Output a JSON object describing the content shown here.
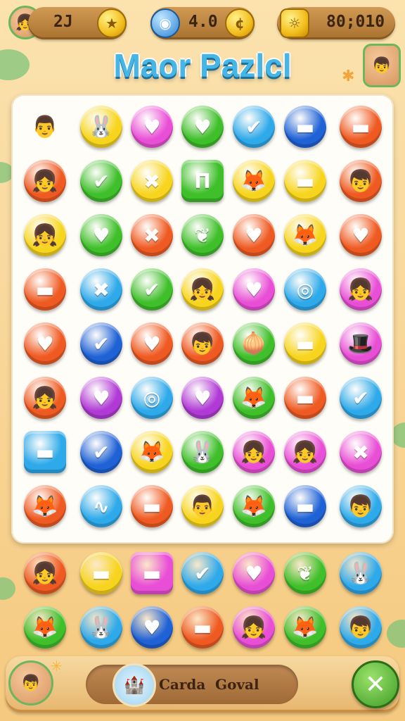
{
  "top_bar": {
    "left_value": "2J",
    "middle_value": "4.0",
    "right_value": "80;010",
    "left_icon": "star-coin-icon",
    "middle_icon": "coin-icon",
    "right_icon": "sun-badge-icon"
  },
  "title": "Maor Pazlcl",
  "bottom_panel": {
    "left_label": "Carda",
    "right_label": "Goval",
    "close_icon": "close-x-icon"
  },
  "colors": {
    "red": "#ef5a22",
    "yellow": "#f7d51e",
    "pink": "#e94fd6",
    "green": "#3fbf2a",
    "lightblue": "#2ea9ea",
    "blue": "#1f62d6",
    "purple": "#b13ad6"
  },
  "board_rows": [
    [
      {
        "c": "none",
        "i": "person-icon",
        "g": "👨"
      },
      {
        "c": "yellow",
        "i": "bunny-icon",
        "g": "🐰"
      },
      {
        "c": "pink",
        "i": "heart-icon",
        "g": "♥"
      },
      {
        "c": "green",
        "i": "heart-icon",
        "g": "♥"
      },
      {
        "c": "lightblue",
        "i": "check-icon",
        "g": "✔"
      },
      {
        "c": "blue",
        "i": "candy-bar-icon",
        "g": "▬"
      },
      {
        "c": "red",
        "i": "candy-bar-icon",
        "g": "▬"
      }
    ],
    [
      {
        "c": "red",
        "i": "girl-face-icon",
        "g": "👧"
      },
      {
        "c": "green",
        "i": "check-icon",
        "g": "✔"
      },
      {
        "c": "yellow",
        "i": "cross-icon",
        "g": "✖"
      },
      {
        "c": "green",
        "i": "square-n-icon",
        "g": "Π",
        "sq": true
      },
      {
        "c": "yellow",
        "i": "fox-icon",
        "g": "🦊"
      },
      {
        "c": "yellow",
        "i": "stick-icon",
        "g": "▬"
      },
      {
        "c": "red",
        "i": "boy-face-icon",
        "g": "👦"
      }
    ],
    [
      {
        "c": "yellow",
        "i": "girl-face-icon",
        "g": "👧"
      },
      {
        "c": "green",
        "i": "heart-icon",
        "g": "♥"
      },
      {
        "c": "red",
        "i": "cross-icon",
        "g": "✖"
      },
      {
        "c": "green",
        "i": "leaf-icon",
        "g": "❦"
      },
      {
        "c": "red",
        "i": "apple-icon",
        "g": "♥"
      },
      {
        "c": "yellow",
        "i": "fox-icon",
        "g": "🦊"
      },
      {
        "c": "red",
        "i": "apple-icon",
        "g": "♥"
      }
    ],
    [
      {
        "c": "red",
        "i": "candy-bar-icon",
        "g": "▬"
      },
      {
        "c": "lightblue",
        "i": "cross-icon",
        "g": "✖"
      },
      {
        "c": "green",
        "i": "check-icon",
        "g": "✔"
      },
      {
        "c": "yellow",
        "i": "girl-face-icon",
        "g": "👧"
      },
      {
        "c": "pink",
        "i": "heart-icon",
        "g": "♥"
      },
      {
        "c": "lightblue",
        "i": "swirl-icon",
        "g": "◎"
      },
      {
        "c": "pink",
        "i": "girl-face-icon",
        "g": "👧"
      }
    ],
    [
      {
        "c": "red",
        "i": "heart-icon",
        "g": "♥"
      },
      {
        "c": "blue",
        "i": "check-icon",
        "g": "✔"
      },
      {
        "c": "red",
        "i": "apple-icon",
        "g": "♥"
      },
      {
        "c": "red",
        "i": "boy-face-icon",
        "g": "👦"
      },
      {
        "c": "green",
        "i": "onion-icon",
        "g": "🧅"
      },
      {
        "c": "yellow",
        "i": "candy-bar-icon",
        "g": "▬"
      },
      {
        "c": "pink",
        "i": "man-hat-icon",
        "g": "🎩"
      }
    ],
    [
      {
        "c": "red",
        "i": "girl-face-icon",
        "g": "👧"
      },
      {
        "c": "purple",
        "i": "heart-icon",
        "g": "♥"
      },
      {
        "c": "lightblue",
        "i": "swirl-icon",
        "g": "◎"
      },
      {
        "c": "purple",
        "i": "heart-icon",
        "g": "♥"
      },
      {
        "c": "green",
        "i": "fox-icon",
        "g": "🦊"
      },
      {
        "c": "red",
        "i": "stick-icon",
        "g": "▬"
      },
      {
        "c": "lightblue",
        "i": "check-icon",
        "g": "✔"
      }
    ],
    [
      {
        "c": "lightblue",
        "i": "candy-bar-icon",
        "g": "▬",
        "sq": true
      },
      {
        "c": "blue",
        "i": "check-icon",
        "g": "✔"
      },
      {
        "c": "yellow",
        "i": "fox-icon",
        "g": "🦊"
      },
      {
        "c": "green",
        "i": "bunny-icon",
        "g": "🐰"
      },
      {
        "c": "pink",
        "i": "girl-face-icon",
        "g": "👧"
      },
      {
        "c": "pink",
        "i": "girl-face-icon",
        "g": "👧"
      },
      {
        "c": "pink",
        "i": "cross-icon",
        "g": "✖"
      }
    ],
    [
      {
        "c": "red",
        "i": "fox-icon",
        "g": "🦊"
      },
      {
        "c": "lightblue",
        "i": "squiggle-icon",
        "g": "∿"
      },
      {
        "c": "red",
        "i": "stick-icon",
        "g": "▬"
      },
      {
        "c": "yellow",
        "i": "person-icon",
        "g": "👨"
      },
      {
        "c": "green",
        "i": "fox-icon",
        "g": "🦊"
      },
      {
        "c": "blue",
        "i": "candy-bar-icon",
        "g": "▬"
      },
      {
        "c": "lightblue",
        "i": "boy-face-icon",
        "g": "👦"
      }
    ]
  ],
  "tray_rows": [
    [
      {
        "c": "red",
        "i": "girl-face-icon",
        "g": "👧"
      },
      {
        "c": "yellow",
        "i": "candy-bar-icon",
        "g": "▬"
      },
      {
        "c": "pink",
        "i": "candy-bar-icon",
        "g": "▬",
        "sq": true
      },
      {
        "c": "lightblue",
        "i": "check-icon",
        "g": "✔"
      },
      {
        "c": "pink",
        "i": "heart-icon",
        "g": "♥"
      },
      {
        "c": "green",
        "i": "leaf-icon",
        "g": "❦"
      },
      {
        "c": "lightblue",
        "i": "bunny-icon",
        "g": "🐰"
      }
    ],
    [
      {
        "c": "green",
        "i": "fox-icon",
        "g": "🦊"
      },
      {
        "c": "lightblue",
        "i": "bunny-icon",
        "g": "🐰"
      },
      {
        "c": "blue",
        "i": "heart-icon",
        "g": "♥"
      },
      {
        "c": "red",
        "i": "candy-bar-icon",
        "g": "▬"
      },
      {
        "c": "pink",
        "i": "girl-face-icon",
        "g": "👧"
      },
      {
        "c": "green",
        "i": "fox-icon",
        "g": "🦊"
      },
      {
        "c": "lightblue",
        "i": "boy-face-icon",
        "g": "👦"
      }
    ]
  ]
}
